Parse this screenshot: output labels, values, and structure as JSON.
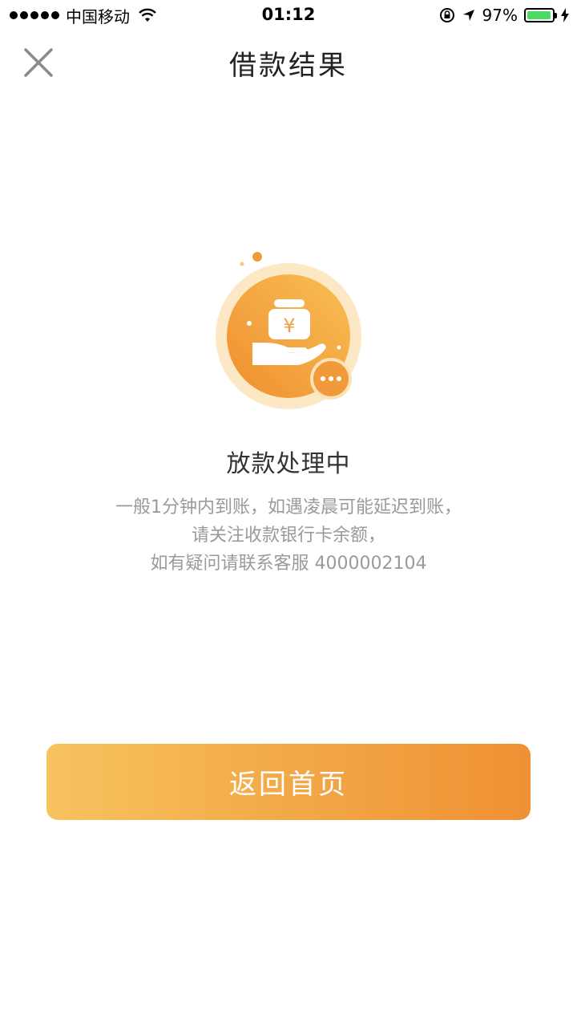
{
  "status_bar": {
    "carrier": "中国移动",
    "time": "01:12",
    "battery_percent": "97%",
    "battery_level": 0.97,
    "battery_color": "#4cd964"
  },
  "nav": {
    "title": "借款结果",
    "close_icon": "close-icon"
  },
  "result": {
    "icon": "hand-money-pending-icon",
    "currency_symbol": "¥",
    "title": "放款处理中",
    "description_lines": [
      "一般1分钟内到账，如遇凌晨可能延迟到账，",
      "请关注收款银行卡余额，",
      "如有疑问请联系客服 4000002104"
    ]
  },
  "actions": {
    "home_label": "返回首页"
  },
  "colors": {
    "accent_start": "#f7c35e",
    "accent_end": "#ef9135",
    "text_muted": "#9a9a9a"
  }
}
